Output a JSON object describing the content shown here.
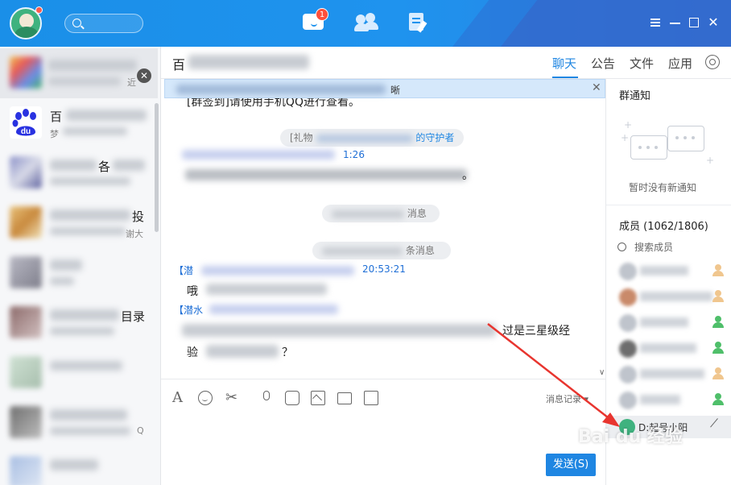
{
  "app": {
    "chat_badge": "1"
  },
  "conversations": [
    {
      "name": "",
      "sub": "近"
    },
    {
      "name": "百",
      "sub": "梦"
    },
    {
      "name": "各",
      "sub": ""
    },
    {
      "name": "投",
      "sub": "谢大"
    },
    {
      "name": "",
      "sub": ""
    },
    {
      "name": "目录",
      "sub": ""
    },
    {
      "name": "",
      "sub": ""
    },
    {
      "name": "",
      "sub": "Q"
    }
  ],
  "chat": {
    "title": "百",
    "tabs": [
      "聊天",
      "公告",
      "文件",
      "应用"
    ],
    "notice_text": "晰",
    "messages": {
      "line1": "[群签到]请使用手机QQ进行查看。",
      "sys1_prefix": "[礼物",
      "sys1_suffix": "的守护者",
      "time1": "1:26",
      "sys2": "消息",
      "sys3": "条消息",
      "sender3": "【潜",
      "time3": "20:53:21",
      "text3": "哦",
      "sender4": "【潜水",
      "text4_end": "过是三星级经",
      "text4_line2": "验",
      "text4_q": "？"
    },
    "toolbar": {
      "history_label": "消息记录",
      "send_label": "发送(S)"
    }
  },
  "right_panel": {
    "group_notice_title": "群通知",
    "no_notice": "暂时没有新通知",
    "members_label": "成员 (1062/1806)",
    "search_placeholder": "搜索成员",
    "me_label": "D:起号小阳"
  },
  "watermark": "Bai du 经验"
}
